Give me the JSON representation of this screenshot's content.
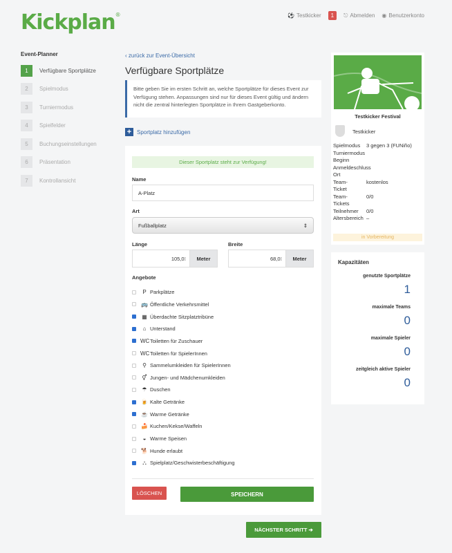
{
  "header": {
    "logo_text": "Kickplan",
    "logo_reg": "®",
    "user_name": "Testkicker",
    "notification_count": "1",
    "logout_label": "Abmelden",
    "account_label": "Benutzerkonto"
  },
  "sidebar": {
    "title": "Event-Planner",
    "steps": [
      {
        "num": "1",
        "label": "Verfügbare Sportplätze",
        "active": true
      },
      {
        "num": "2",
        "label": "Spielmodus"
      },
      {
        "num": "3",
        "label": "Turniermodus"
      },
      {
        "num": "4",
        "label": "Spielfelder"
      },
      {
        "num": "5",
        "label": "Buchungseinstellungen"
      },
      {
        "num": "6",
        "label": "Präsentation"
      },
      {
        "num": "7",
        "label": "Kontrollansicht"
      }
    ]
  },
  "main": {
    "back_link": "zurück zur Event-Übersicht",
    "title": "Verfügbare Sportplätze",
    "info_text": "Bitte geben Sie im ersten Schritt an, welche Sportplätze für dieses Event zur Verfügung stehen. Anpassungen sind nur für dieses Event gültig und ändern nicht die zentral hinterlegten Sportplätze in Ihrem Gastgeberkonto.",
    "add_label": "Sportplatz hinzufügen"
  },
  "form": {
    "alert": "Dieser Sportplatz steht zur Verfügung!",
    "name_label": "Name",
    "name_value": "A-Platz",
    "type_label": "Art",
    "type_value": "Fußballplatz",
    "length_label": "Länge",
    "length_value": "105,0",
    "width_label": "Breite",
    "width_value": "68,0",
    "unit": "Meter",
    "amenities_label": "Angebote",
    "amenities": [
      {
        "label": "Parkplätze",
        "checked": false,
        "icon": "parking-icon",
        "glyph": "P"
      },
      {
        "label": "Öffentliche Verkehrsmittel",
        "checked": false,
        "icon": "bus-icon",
        "glyph": "🚌"
      },
      {
        "label": "Überdachte Sitzplatztribüne",
        "checked": true,
        "icon": "grandstand-icon",
        "glyph": "▦"
      },
      {
        "label": "Unterstand",
        "checked": true,
        "icon": "shelter-icon",
        "glyph": "⌂"
      },
      {
        "label": "Toiletten für Zuschauer",
        "checked": true,
        "icon": "wc-icon",
        "glyph": "WC"
      },
      {
        "label": "Toiletten für SpielerInnen",
        "checked": false,
        "icon": "wc-icon",
        "glyph": "WC"
      },
      {
        "label": "Sammelumkleiden für SpielerInnen",
        "checked": false,
        "icon": "locker-room-icon",
        "glyph": "⚲"
      },
      {
        "label": "Jungen- und Mädchenumkleiden",
        "checked": false,
        "icon": "changing-rooms-icon",
        "glyph": "⚥"
      },
      {
        "label": "Duschen",
        "checked": false,
        "icon": "shower-icon",
        "glyph": "☂"
      },
      {
        "label": "Kalte Getränke",
        "checked": true,
        "icon": "cold-drink-icon",
        "glyph": "🍺"
      },
      {
        "label": "Warme Getränke",
        "checked": true,
        "icon": "hot-drink-icon",
        "glyph": "☕"
      },
      {
        "label": "Kuchen/Kekse/Waffeln",
        "checked": false,
        "icon": "cake-icon",
        "glyph": "🍰"
      },
      {
        "label": "Warme Speisen",
        "checked": false,
        "icon": "hot-food-icon",
        "glyph": "◒"
      },
      {
        "label": "Hunde erlaubt",
        "checked": false,
        "icon": "dog-icon",
        "glyph": "🐕"
      },
      {
        "label": "Spielplatz/Geschwisterbeschäftigung",
        "checked": true,
        "icon": "playground-icon",
        "glyph": "⛬"
      }
    ],
    "delete_label": "LÖSCHEN",
    "save_label": "SPEICHERN"
  },
  "next_label": "NÄCHSTER SCHRITT ➔",
  "event": {
    "name": "Testkicker Festival",
    "host": "Testkicker",
    "details": [
      {
        "k": "Spielmodus",
        "v": "3 gegen 3 (FUNiño)"
      },
      {
        "k": "Turniermodus",
        "v": ""
      },
      {
        "k": "Beginn",
        "v": ""
      },
      {
        "k": "Anmeldeschluss",
        "v": ""
      },
      {
        "k": "Ort",
        "v": ""
      },
      {
        "k": "Team-",
        "v": "kostenlos"
      },
      {
        "k": "Ticket",
        "v": ""
      },
      {
        "k": "Team-",
        "v": "0/0"
      },
      {
        "k": "Tickets",
        "v": ""
      },
      {
        "k": "Teilnehmer",
        "v": "0/0"
      },
      {
        "k": "Altersbereich",
        "v": "–"
      }
    ],
    "status": "in Vorbereitung"
  },
  "capacity": {
    "title": "Kapazitäten",
    "items": [
      {
        "label": "genutzte Sportplätze",
        "value": "1"
      },
      {
        "label": "maximale Teams",
        "value": "0"
      },
      {
        "label": "maximale Spieler",
        "value": "0"
      },
      {
        "label": "zeitgleich aktive Spieler",
        "value": "0"
      }
    ]
  },
  "colors": {
    "brand": "#5aab47",
    "link": "#3a6aa7",
    "danger": "#d9534f",
    "primary": "#4a9a3a"
  }
}
